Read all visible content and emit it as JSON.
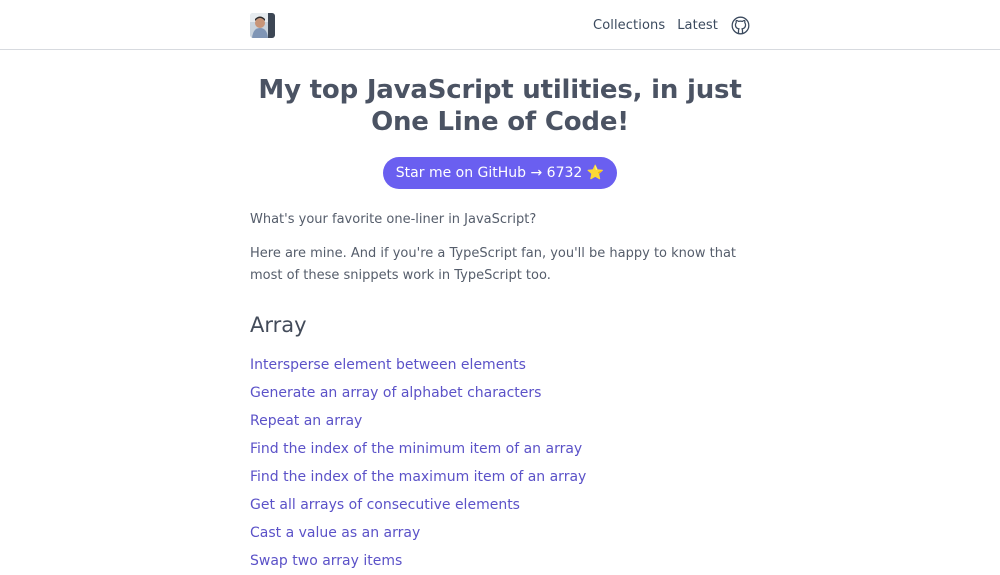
{
  "nav": {
    "collections_label": "Collections",
    "latest_label": "Latest"
  },
  "header": {
    "title_line1": "My top JavaScript utilities, in just",
    "title_line2": "One Line of Code!"
  },
  "cta": {
    "text": "Star me on GitHub → 6732",
    "star": "⭐"
  },
  "intro": {
    "p1": "What's your favorite one-liner in JavaScript?",
    "p2_line1": "Here are mine. And if you're a TypeScript fan, you'll be happy to know that",
    "p2_line2": "most of these snippets work in TypeScript too."
  },
  "section": {
    "heading": "Array",
    "links": [
      "Intersperse element between elements",
      "Generate an array of alphabet characters",
      "Repeat an array",
      "Find the index of the minimum item of an array",
      "Find the index of the maximum item of an array",
      "Get all arrays of consecutive elements",
      "Cast a value as an array",
      "Swap two array items"
    ]
  },
  "icons": {
    "avatar": "avatar",
    "github": "github-icon"
  },
  "colors": {
    "accent": "#6a5ff0",
    "link": "#5b52c8",
    "heading": "#4b5363"
  }
}
